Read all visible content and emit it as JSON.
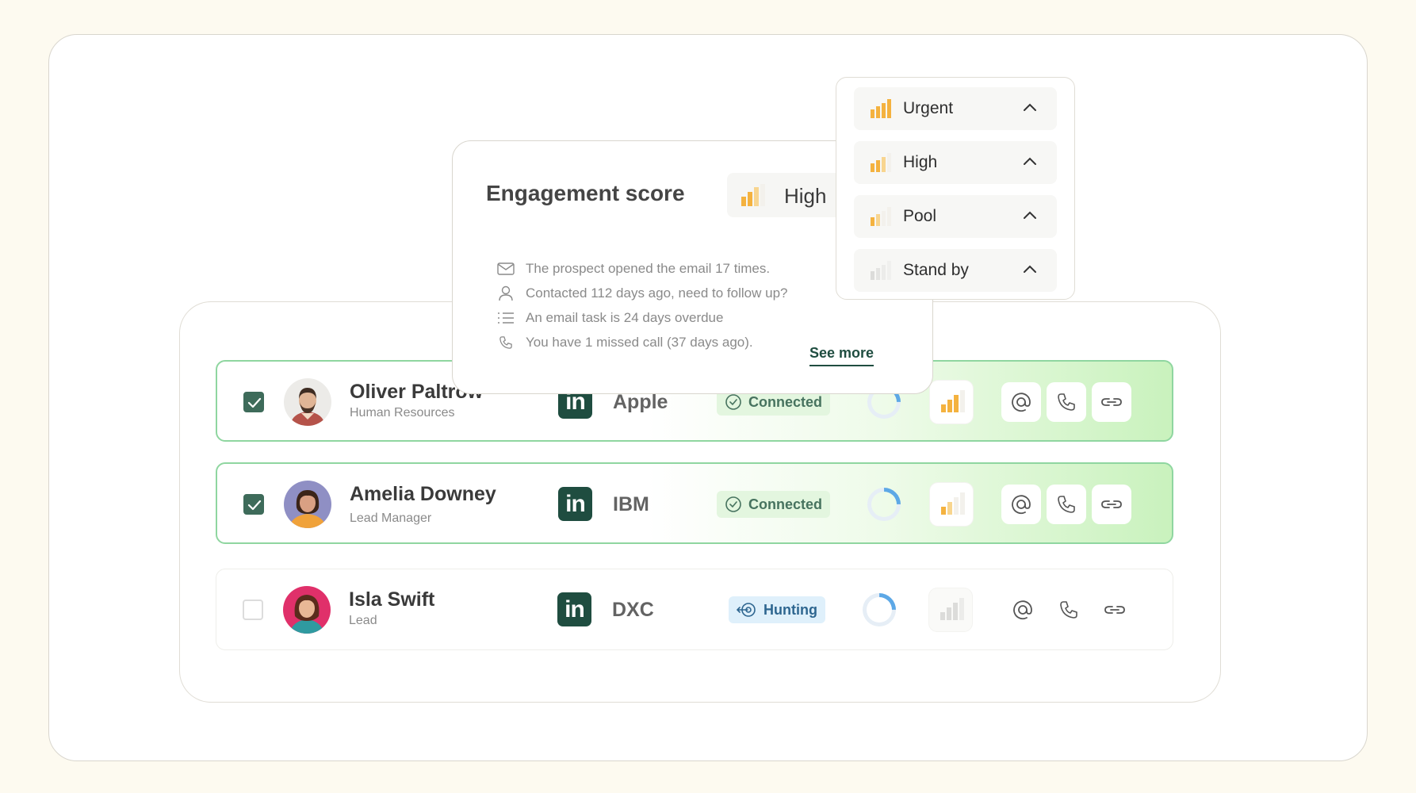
{
  "colors": {
    "accent_dark_green": "#1f4d40",
    "connected_bg": "#e3f6df",
    "connected_text": "#47735f",
    "hunting_bg": "#dff0fb",
    "hunting_text": "#2e6690",
    "priority_orange": "#f4b23f",
    "selected_row_gradient_end": "#c9f2bd"
  },
  "engagement_popup": {
    "title": "Engagement score",
    "priority_label": "High",
    "insights": [
      {
        "icon": "mail-icon",
        "text": "The prospect opened the email 17 times."
      },
      {
        "icon": "person-icon",
        "text": "Contacted 112 days ago, need to follow up?"
      },
      {
        "icon": "list-icon",
        "text": "An email task is 24 days overdue"
      },
      {
        "icon": "phone-icon",
        "text": "You have 1 missed call (37 days ago)."
      }
    ],
    "see_more": "See more"
  },
  "priority_dropdown": {
    "options": [
      {
        "label": "Urgent",
        "level": 4
      },
      {
        "label": "High",
        "level": 3
      },
      {
        "label": "Pool",
        "level": 2
      },
      {
        "label": "Stand by",
        "level": 1
      }
    ]
  },
  "prospects": [
    {
      "name": "Oliver Paltrow",
      "role": "Human Resources",
      "linkedin": "in",
      "company": "Apple",
      "status": "Connected",
      "selected": true,
      "priority_level": 3
    },
    {
      "name": "Amelia Downey",
      "role": "Lead Manager",
      "linkedin": "in",
      "company": "IBM",
      "status": "Connected",
      "selected": true,
      "priority_level": 2
    },
    {
      "name": "Isla Swift",
      "role": "Lead",
      "linkedin": "in",
      "company": "DXC",
      "status": "Hunting",
      "selected": false,
      "priority_level": 0
    }
  ]
}
